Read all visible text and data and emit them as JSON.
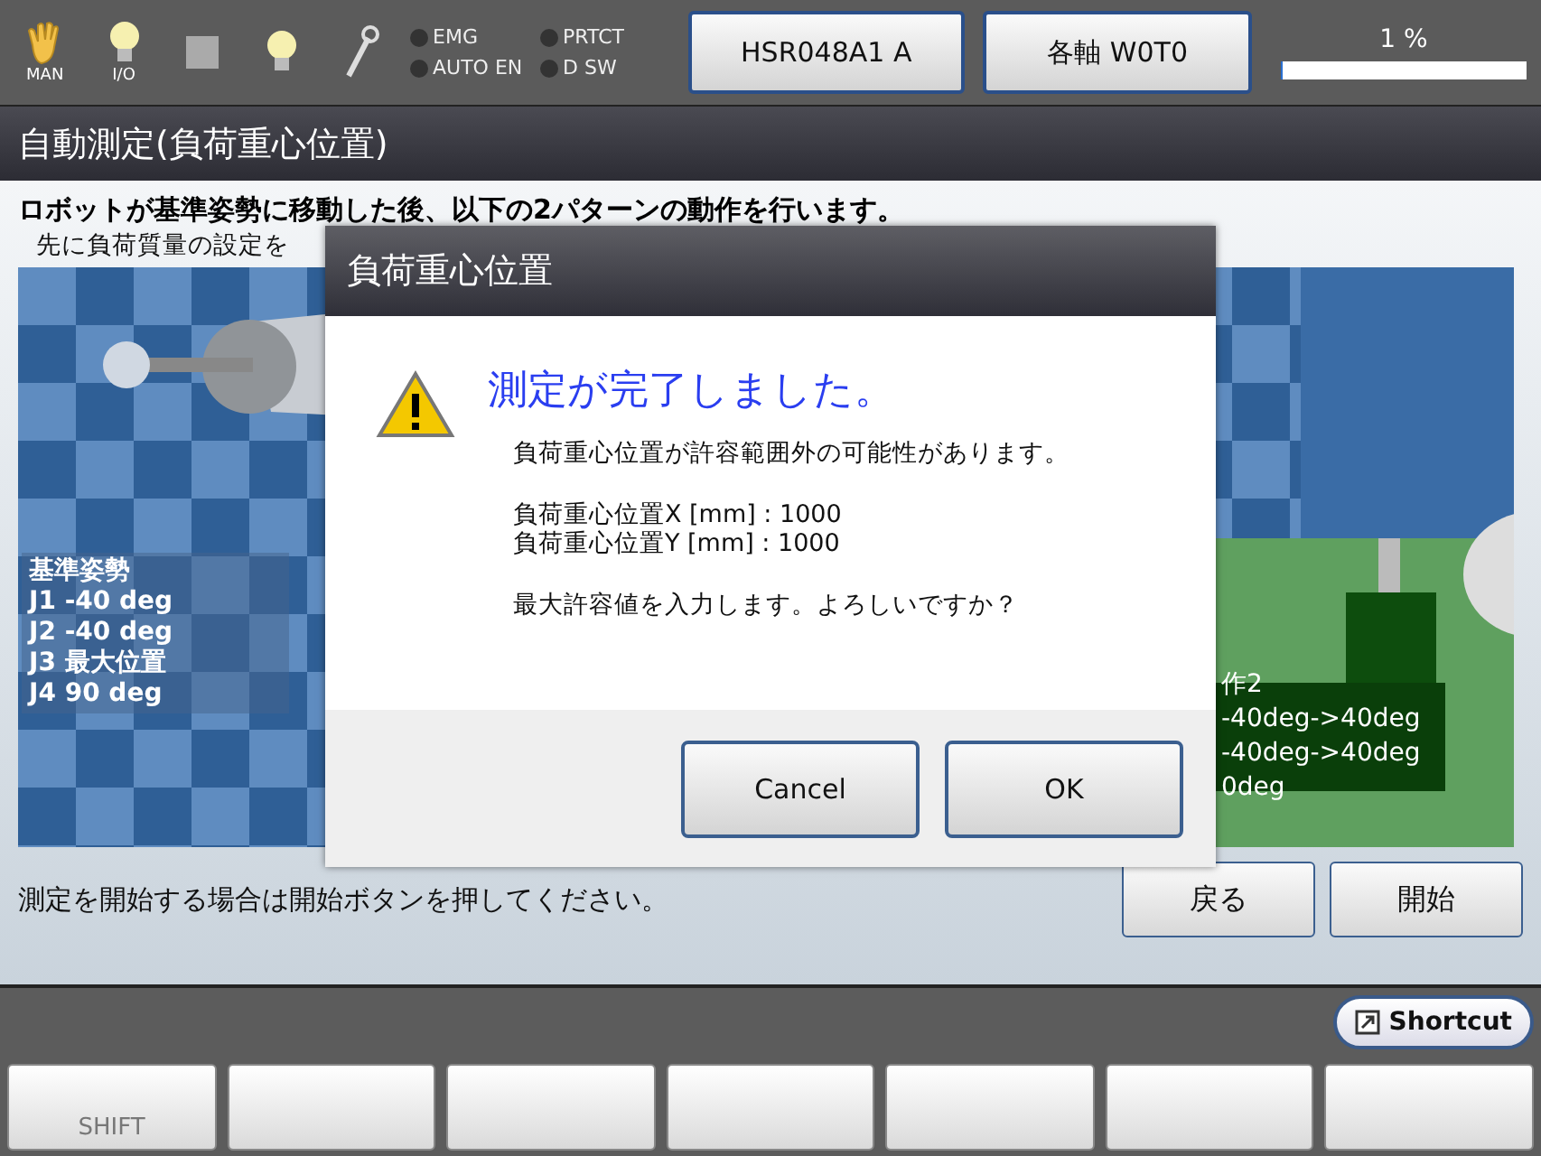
{
  "toolbar": {
    "icons": [
      {
        "kind": "hand",
        "label": "MAN"
      },
      {
        "kind": "bulb",
        "label": "I/O"
      },
      {
        "kind": "square"
      },
      {
        "kind": "bulb"
      },
      {
        "kind": "wrench"
      }
    ],
    "indicators": [
      {
        "label": "EMG",
        "on": false
      },
      {
        "label": "PRTCT",
        "on": false
      },
      {
        "label": "AUTO EN",
        "on": false
      },
      {
        "label": "D SW",
        "on": false
      }
    ],
    "buttons": [
      "HSR048A1 A",
      "各軸 W0T0"
    ],
    "progress": {
      "reading": "1 %",
      "level": 0.01
    }
  },
  "screen_title": "自動測定(負荷重心位置)",
  "instructions": [
    "ロボットが基準姿勢に移動した後、以下の2パターンの動作を行います。",
    "先に負荷質量の設定を"
  ],
  "picture": {
    "left_caption": [
      "基準姿勢",
      "J1 -40 deg",
      "J2 -40 deg",
      "J3 最大位置",
      "J4 90 deg"
    ],
    "right_caption": [
      "作2",
      "-40deg->40deg",
      "-40deg->40deg",
      "0deg"
    ]
  },
  "status_text": "測定を開始する場合は開始ボタンを押してください。",
  "actions": [
    "戻る",
    "開始"
  ],
  "shortcut": "Shortcut",
  "function_keys": [
    {
      "kind": "labeled",
      "label": "SHIFT"
    },
    {
      "kind": "blank"
    },
    {
      "kind": "blank"
    },
    {
      "kind": "blank"
    },
    {
      "kind": "blank"
    },
    {
      "kind": "blank"
    },
    {
      "kind": "blank"
    }
  ],
  "dialog": {
    "title": "負荷重心位置",
    "heading": "測定が完了しました。",
    "message": "負荷重心位置が許容範囲外の可能性があります。",
    "values": [
      "負荷重心位置X [mm] : 1000",
      "負荷重心位置Y [mm] : 1000"
    ],
    "question": "最大許容値を入力します。よろしいですか？",
    "buttons": [
      "Cancel",
      "OK"
    ]
  }
}
